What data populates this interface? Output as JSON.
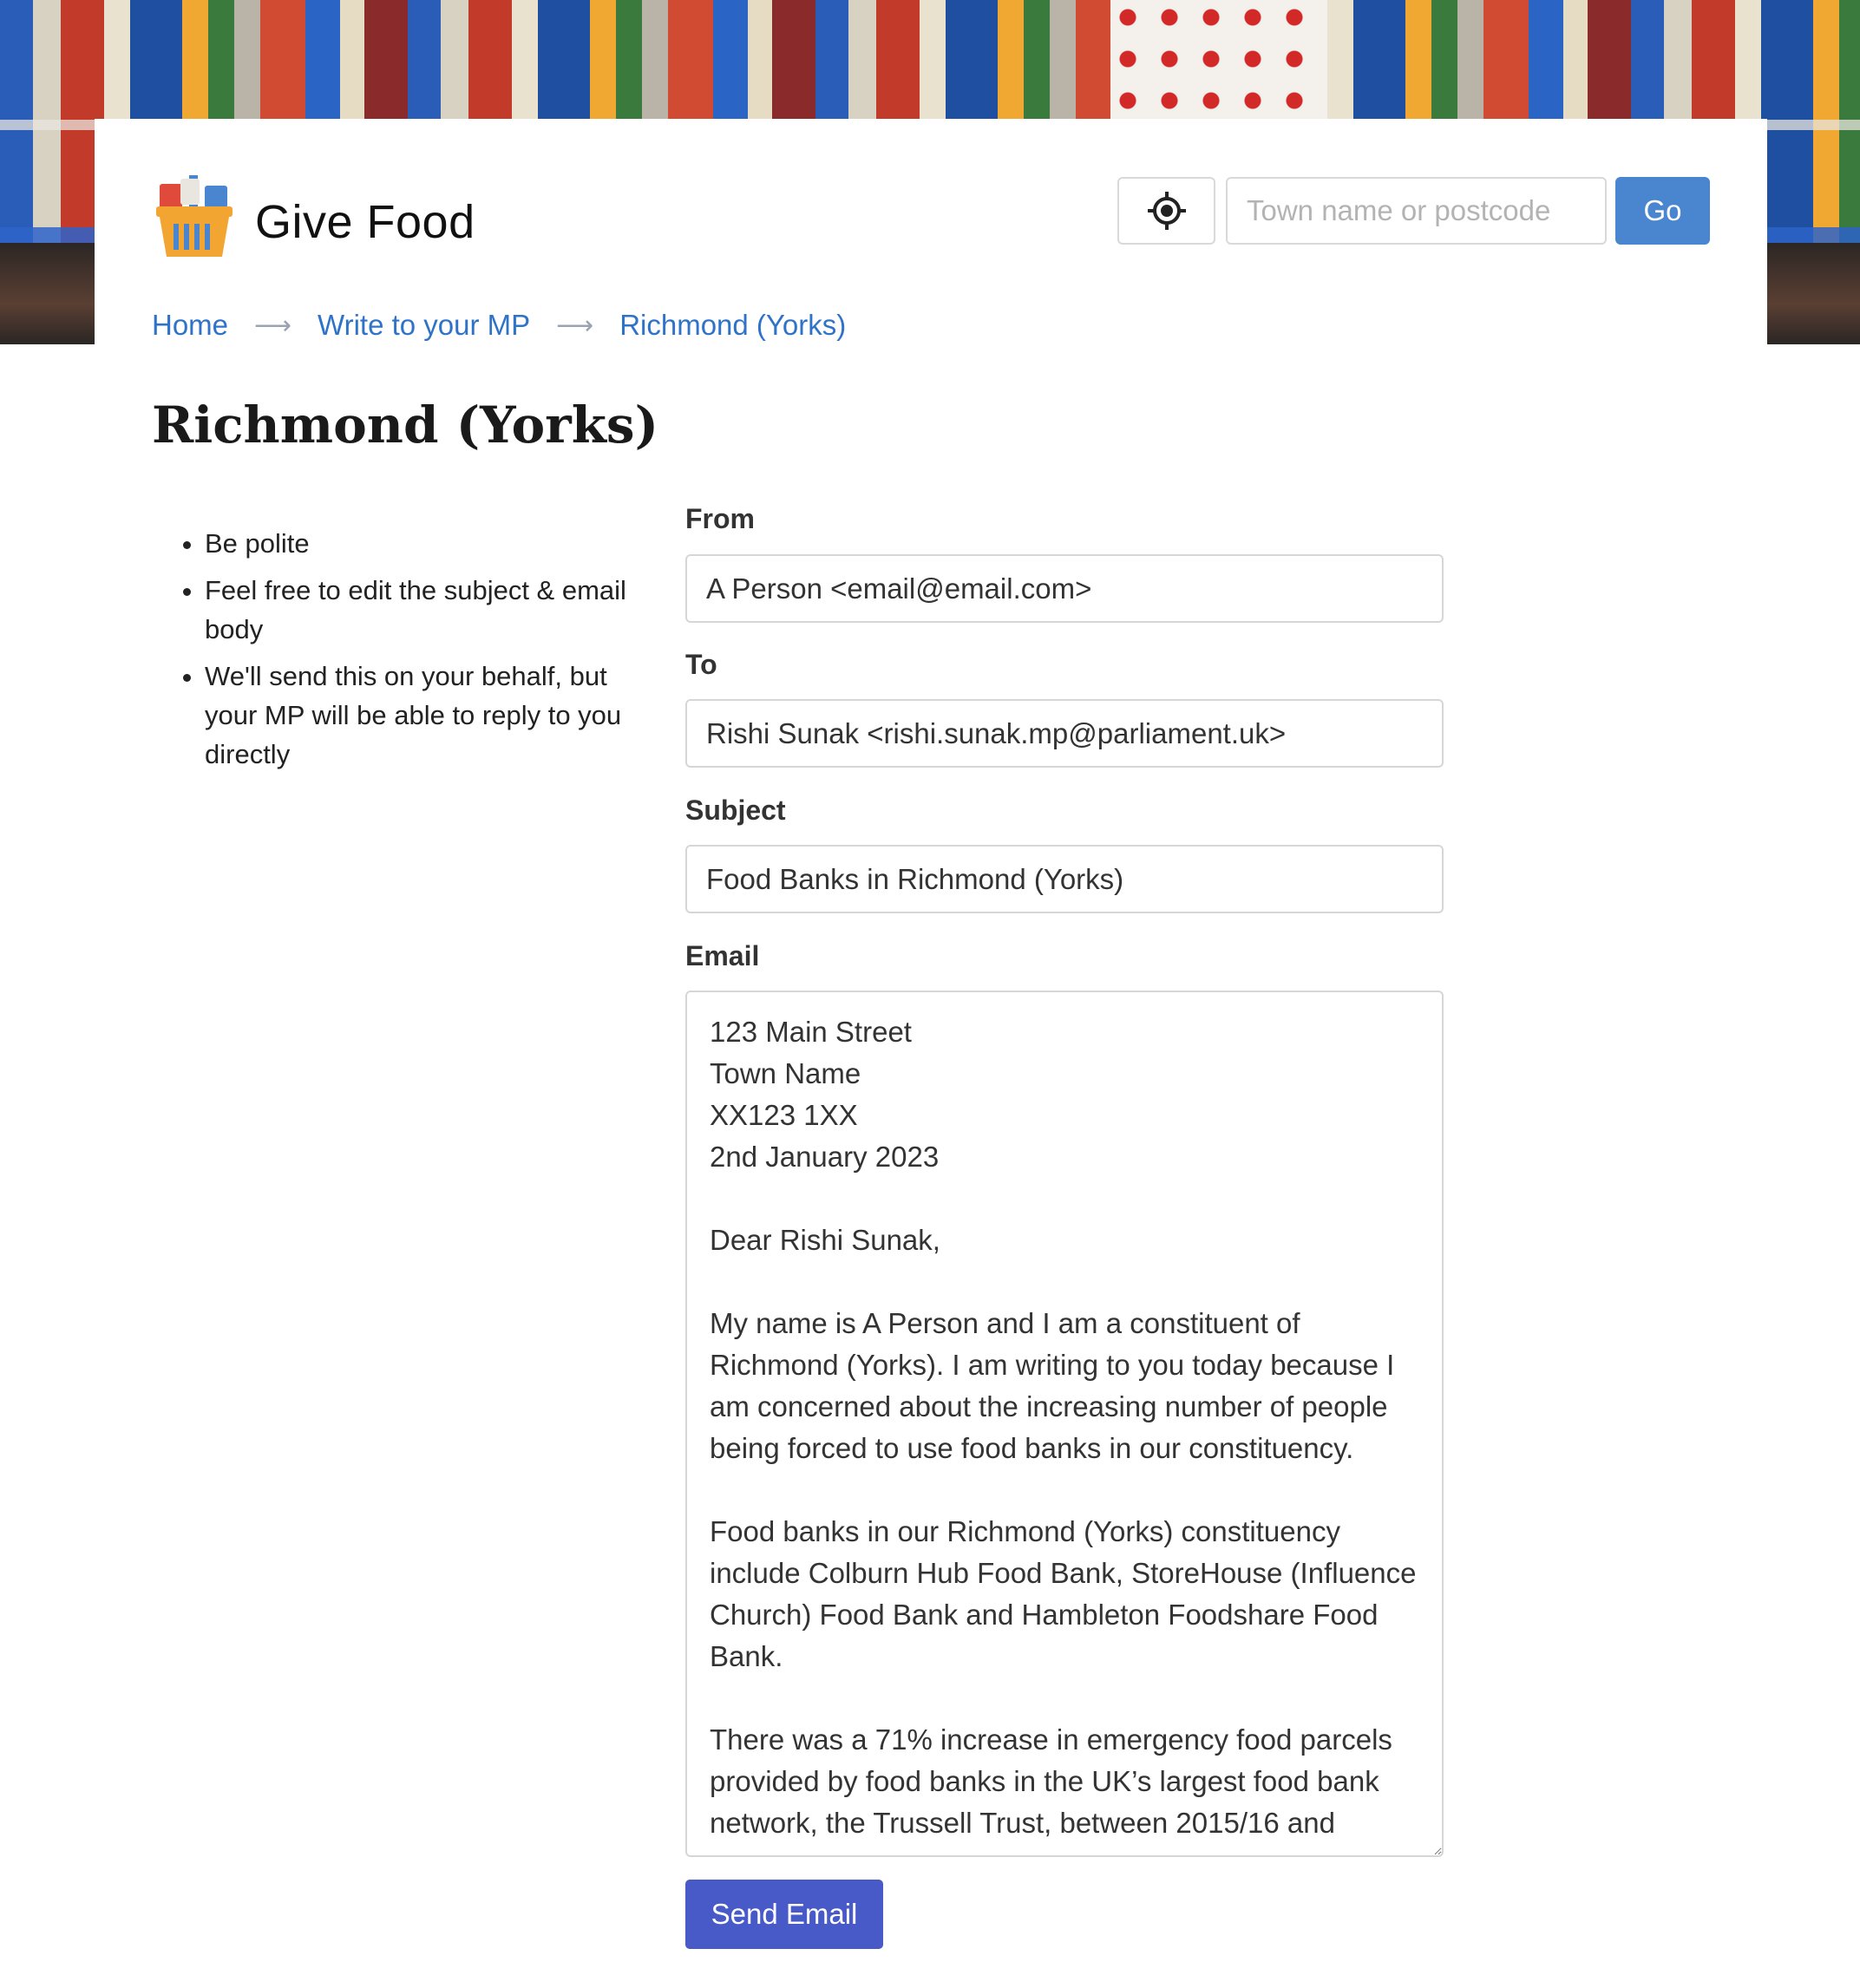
{
  "header": {
    "brand": "Give Food",
    "locate_icon": "crosshair-icon",
    "search_placeholder": "Town name or postcode",
    "go_label": "Go"
  },
  "breadcrumb": [
    "Home",
    "Write to your MP",
    "Richmond (Yorks)"
  ],
  "page_title": "Richmond (Yorks)",
  "tips": [
    "Be polite",
    "Feel free to edit the subject & email body",
    "We'll send this on your behalf, but your MP will be able to reply to you directly"
  ],
  "form": {
    "from_label": "From",
    "from_value": "A Person <email@email.com>",
    "to_label": "To",
    "to_value": "Rishi Sunak <rishi.sunak.mp@parliament.uk>",
    "subject_label": "Subject",
    "subject_value": "Food Banks in Richmond (Yorks)",
    "email_label": "Email",
    "email_body": "123 Main Street\nTown Name\nXX123 1XX\n2nd January 2023\n\nDear Rishi Sunak,\n\nMy name is A Person and I am a constituent of Richmond (Yorks). I am writing to you today because I am concerned about the increasing number of people being forced to use food banks in our constituency.\n\nFood banks in our Richmond (Yorks) constituency include Colburn Hub Food Bank, StoreHouse (Influence Church) Food Bank and Hambleton Foodshare Food Bank.\n\nThere was a 71% increase in emergency food parcels provided by food banks in the UK’s largest food bank network, the Trussell Trust, between 2015/16 and",
    "send_label": "Send Email"
  }
}
